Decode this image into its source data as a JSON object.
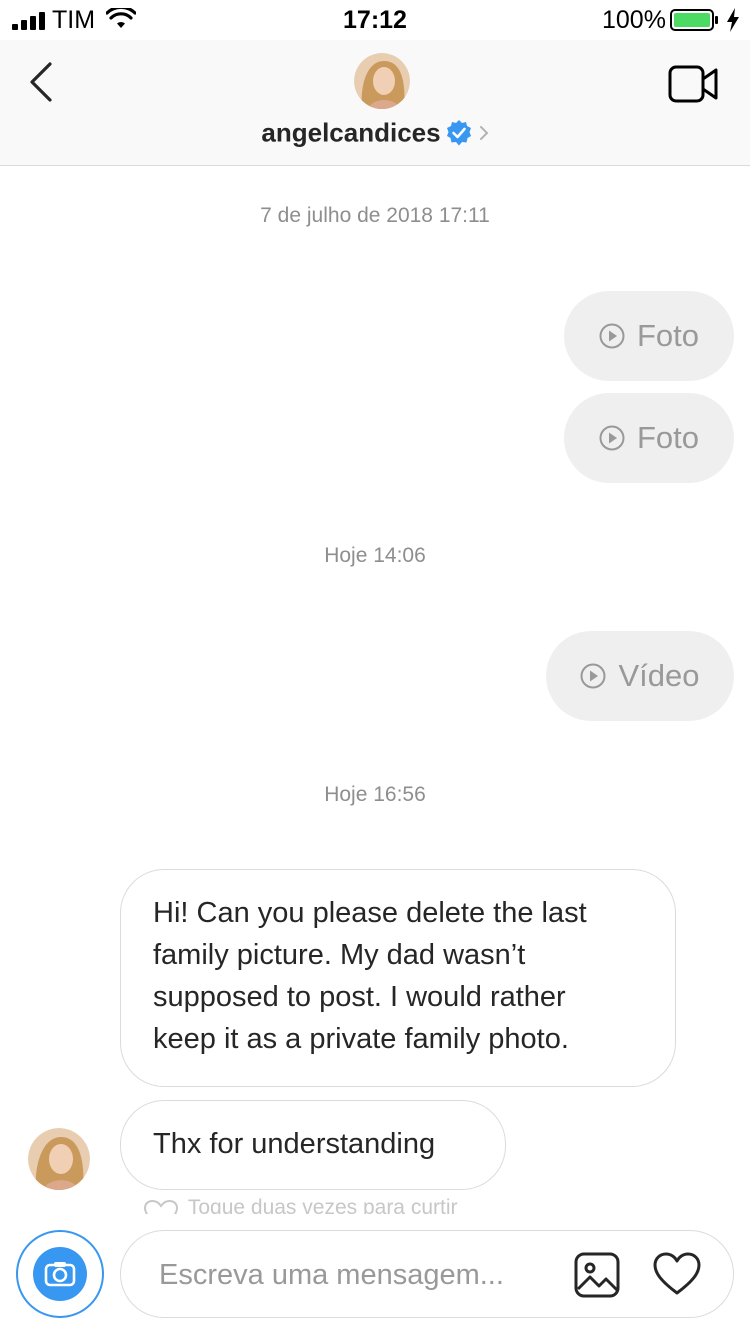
{
  "status_bar": {
    "carrier": "TIM",
    "time": "17:12",
    "battery": "100%"
  },
  "header": {
    "username": "angelcandices",
    "verified": true,
    "icons": [
      "back-chevron-icon",
      "verified-badge-icon",
      "chevron-right-icon",
      "video-call-icon"
    ]
  },
  "thread": {
    "timestamps": [
      "7 de julho de 2018 17:11",
      "Hoje 14:06",
      "Hoje 16:56"
    ],
    "sent": [
      {
        "label": "Foto",
        "icon": "play-circle-icon"
      },
      {
        "label": "Foto",
        "icon": "play-circle-icon"
      },
      {
        "label": "Vídeo",
        "icon": "play-circle-icon"
      }
    ],
    "received": [
      {
        "lines": [
          "Hi! Can you please delete the last",
          "family picture. My dad wasn’t",
          "supposed to post. I would rather",
          "keep it as a private family photo."
        ]
      },
      {
        "text": "Thx for understanding"
      }
    ],
    "like_hint": "Toque duas vezes para curtir"
  },
  "composer": {
    "placeholder": "Escreva uma mensagem...",
    "value": "",
    "icons": [
      "camera-icon",
      "gallery-icon",
      "heart-icon"
    ]
  },
  "colors": {
    "accent": "#3897f0",
    "bubble_sent": "#efefef",
    "bubble_border": "#dbdbdb",
    "muted_text": "#8e8e8e",
    "battery": "#4cd964"
  }
}
